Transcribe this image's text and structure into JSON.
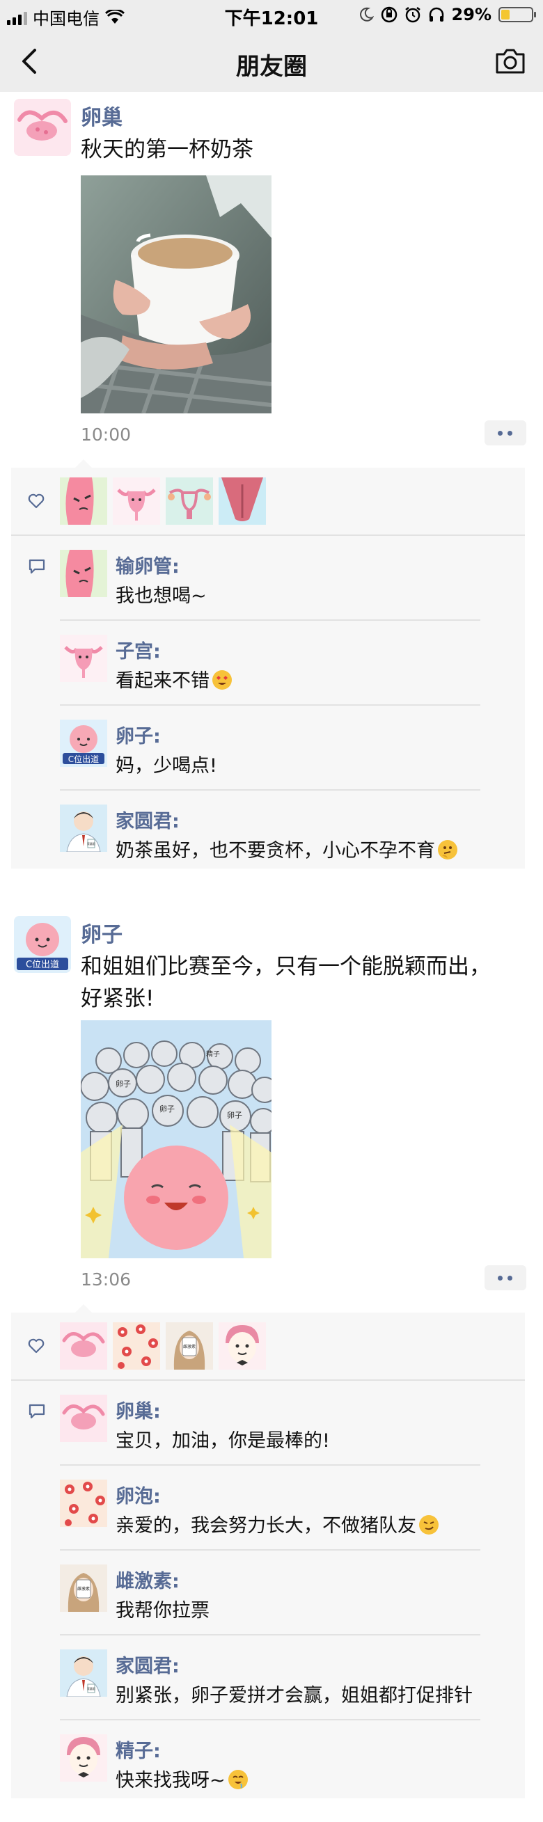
{
  "status_bar": {
    "carrier": "中国电信",
    "time": "下午12:01",
    "battery": "29%",
    "battery_level": 0.29
  },
  "nav": {
    "title": "朋友圈"
  },
  "posts": [
    {
      "author": "卵巢",
      "text": "秋天的第一杯奶茶",
      "time": "10:00",
      "comments": [
        {
          "name": "输卵管:",
          "text": "我也想喝~",
          "emoji": ""
        },
        {
          "name": "子宫:",
          "text": "看起来不错",
          "emoji": "heart-eyes-emoji"
        },
        {
          "name": "卵子:",
          "text": "妈，少喝点!",
          "emoji": ""
        },
        {
          "name": "家圆君:",
          "text": "奶茶虽好，也不要贪杯，小心不孕不育",
          "emoji": "thinking-emoji"
        }
      ]
    },
    {
      "author": "卵子",
      "text": "和姐姐们比赛至今，只有一个能脱颖而出，好紧张!",
      "time": "13:06",
      "image_labels": {
        "cell": "卵子",
        "sperm": "精子"
      },
      "comments": [
        {
          "name": "卵巢:",
          "text": "宝贝，加油，你是最棒的!",
          "emoji": ""
        },
        {
          "name": "卵泡:",
          "text": "亲爱的，我会努力长大，不做猪队友",
          "emoji": "smirk-emoji"
        },
        {
          "name": "雌激素:",
          "text": "我帮你拉票",
          "emoji": ""
        },
        {
          "name": "家圆君:",
          "text": "别紧张，卵子爱拼才会赢，姐姐都打促排针",
          "emoji": ""
        },
        {
          "name": "精子:",
          "text": "快来找我呀~",
          "emoji": "drool-emoji"
        }
      ]
    }
  ],
  "avatar_labels": {
    "ovum_badge": "C位出道",
    "estrogen_badge": "雌激素",
    "doctor_badge": "家圆君"
  }
}
